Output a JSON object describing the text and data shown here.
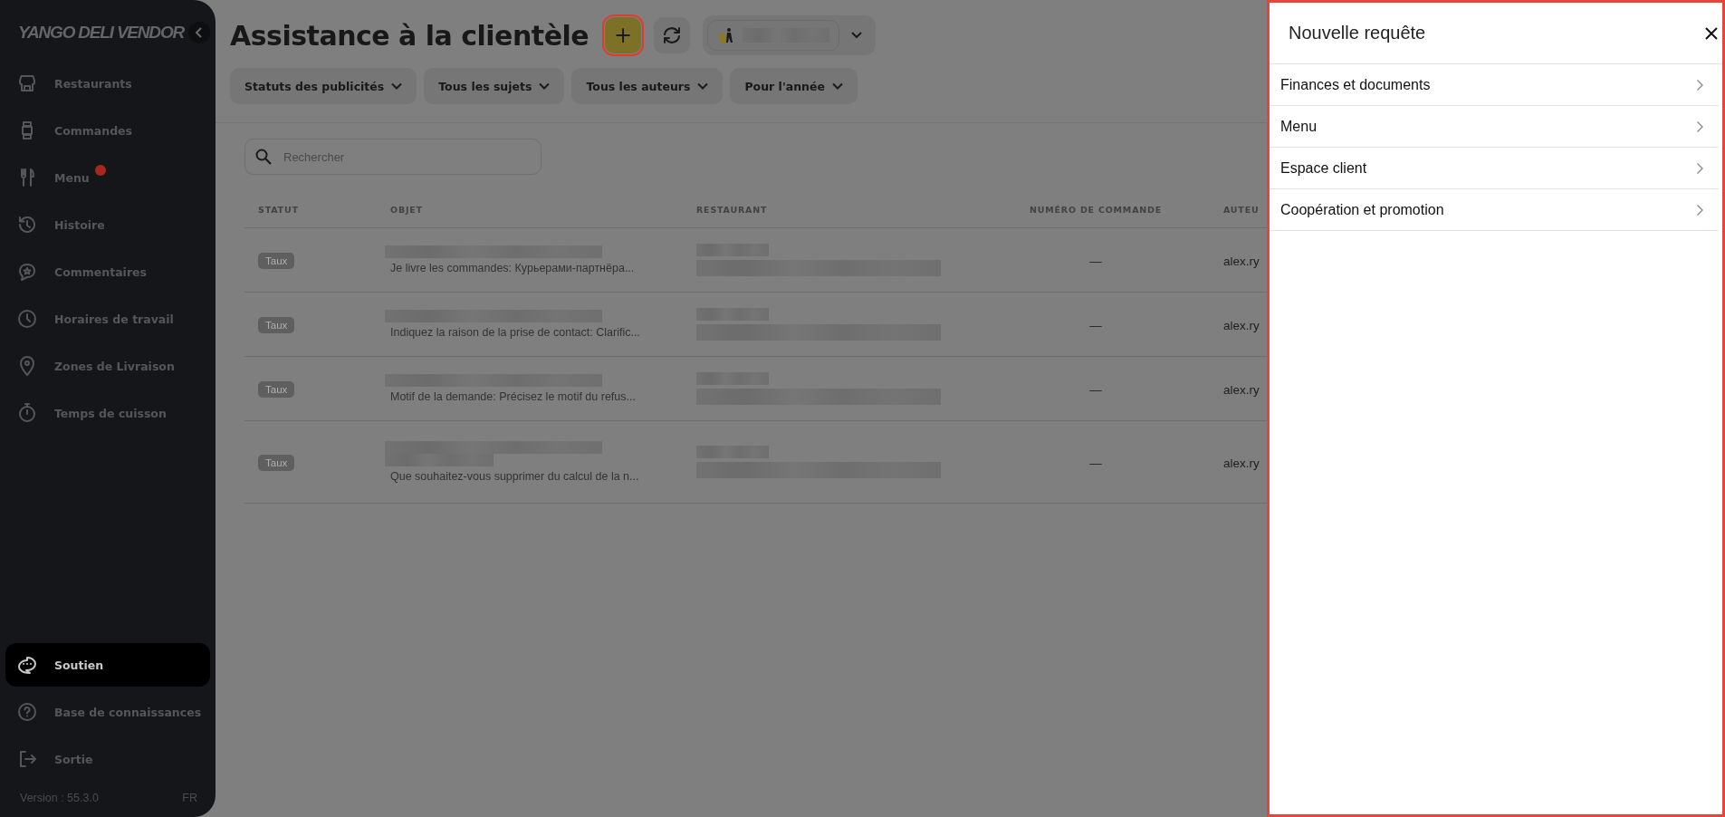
{
  "sidebar": {
    "logo": "YANGO DELI VENDOR",
    "items": [
      {
        "label": "Restaurants",
        "selected": false,
        "notification": false
      },
      {
        "label": "Commandes",
        "selected": false,
        "notification": false
      },
      {
        "label": "Menu",
        "selected": false,
        "notification": true
      },
      {
        "label": "Histoire",
        "selected": false,
        "notification": false
      },
      {
        "label": "Commentaires",
        "selected": false,
        "notification": false
      },
      {
        "label": "Horaires de travail",
        "selected": false,
        "notification": false
      },
      {
        "label": "Zones de Livraison",
        "selected": false,
        "notification": false
      },
      {
        "label": "Temps de cuisson",
        "selected": false,
        "notification": false
      }
    ],
    "footer_items": [
      {
        "label": "Soutien",
        "selected": true
      },
      {
        "label": "Base de connaissances",
        "selected": false
      },
      {
        "label": "Sortie",
        "selected": false
      }
    ],
    "version": "Version : 55.3.0",
    "language": "FR"
  },
  "header": {
    "title": "Assistance à la clientèle",
    "add_button": {
      "label": "+",
      "highlighted": true
    }
  },
  "filters": [
    "Statuts des publicités",
    "Tous les sujets",
    "Tous les auteurs",
    "Pour l'année"
  ],
  "search": {
    "placeholder": "Rechercher"
  },
  "table": {
    "columns": [
      "STATUT",
      "OBJET",
      "RESTAURANT",
      "NUMÉRO DE COMMANDE",
      "AUTEU"
    ],
    "rows": [
      {
        "status": "Taux",
        "subject": "Je livre les commandes: Курьерами-партнёра...",
        "order": "—",
        "author": "alex.ry"
      },
      {
        "status": "Taux",
        "subject": "Indiquez la raison de la prise de contact: Clarific...",
        "order": "—",
        "author": "alex.ry"
      },
      {
        "status": "Taux",
        "subject": "Motif de la demande: Précisez le motif du refus...",
        "order": "—",
        "author": "alex.ry"
      },
      {
        "status": "Taux",
        "subject": "Que souhaitez-vous supprimer du calcul de la n...",
        "order": "—",
        "author": "alex.ry"
      }
    ]
  },
  "panel": {
    "title": "Nouvelle requête",
    "highlighted": true,
    "items": [
      "Finances et documents",
      "Menu",
      "Espace client",
      "Coopération et promotion"
    ]
  }
}
